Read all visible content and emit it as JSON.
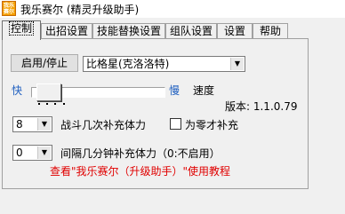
{
  "window": {
    "icon_text": "我乐\n赛尔",
    "title": "我乐赛尔 (精灵升级助手)"
  },
  "tabs": [
    {
      "label": "控制",
      "active": true
    },
    {
      "label": "出招设置",
      "active": false
    },
    {
      "label": "技能替换设置",
      "active": false
    },
    {
      "label": "组队设置",
      "active": false
    },
    {
      "label": "设置",
      "active": false
    },
    {
      "label": "帮助",
      "active": false
    }
  ],
  "control": {
    "start_stop_label": "启用/停止",
    "pet_select": {
      "value": "比格星(克洛洛特)",
      "arrow": "▼"
    },
    "speed": {
      "fast_label": "快",
      "slow_label": "慢",
      "speed_label": "速度",
      "position": 0.2
    },
    "version": "版本: 1.1.0.79",
    "battles_select": {
      "value": "8",
      "arrow": "▼"
    },
    "battles_label": "战斗几次补充体力",
    "zero_checkbox": {
      "label": "为零才补充",
      "checked": false
    },
    "interval_select": {
      "value": "0",
      "arrow": "▼"
    },
    "interval_label": "间隔几分钟补充体力（0:不启用）",
    "help_link": "查看\"我乐赛尔（升级助手）\"使用教程"
  },
  "colors": {
    "link": "#e00000",
    "speed_labels": "#2060c0"
  }
}
